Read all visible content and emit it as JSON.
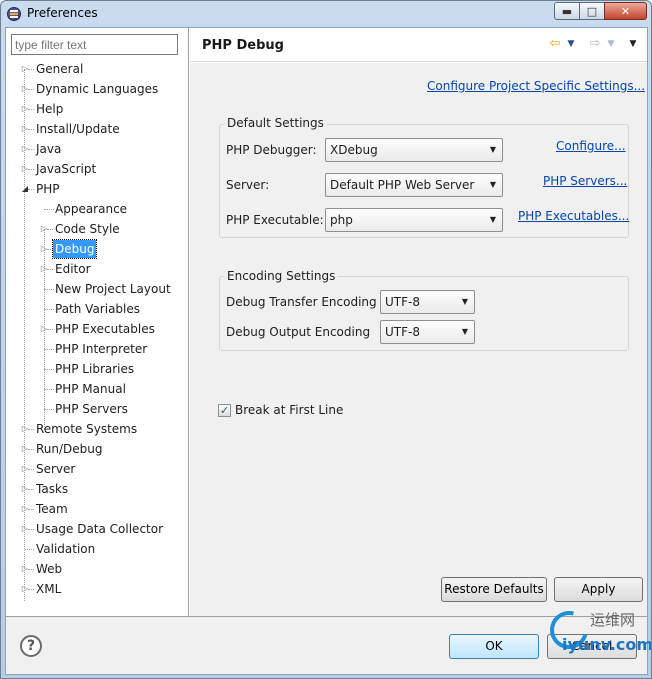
{
  "window": {
    "title": "Preferences"
  },
  "filter": {
    "placeholder": "type filter text"
  },
  "tree": {
    "general": "General",
    "dynamic_languages": "Dynamic Languages",
    "help": "Help",
    "install_update": "Install/Update",
    "java": "Java",
    "javascript": "JavaScript",
    "php": "PHP",
    "appearance": "Appearance",
    "code_style": "Code Style",
    "debug": "Debug",
    "editor": "Editor",
    "new_project_layout": "New Project Layout",
    "path_variables": "Path Variables",
    "php_executables": "PHP Executables",
    "php_interpreter": "PHP Interpreter",
    "php_libraries": "PHP Libraries",
    "php_manual": "PHP Manual",
    "php_servers": "PHP Servers",
    "remote_systems": "Remote Systems",
    "run_debug": "Run/Debug",
    "server": "Server",
    "tasks": "Tasks",
    "team": "Team",
    "usage_data_collector": "Usage Data Collector",
    "validation": "Validation",
    "web": "Web",
    "xml": "XML"
  },
  "page": {
    "title": "PHP Debug",
    "configure_project_link": "Configure Project Specific Settings...",
    "default_settings": {
      "title": "Default Settings",
      "debugger_label": "PHP Debugger:",
      "debugger_value": "XDebug",
      "configure_link": "Configure...",
      "server_label": "Server:",
      "server_value": "Default PHP Web Server",
      "servers_link": "PHP Servers...",
      "executable_label": "PHP Executable:",
      "executable_value": "php",
      "executables_link": "PHP Executables..."
    },
    "encoding_settings": {
      "title": "Encoding Settings",
      "transfer_label": "Debug Transfer Encoding",
      "transfer_value": "UTF-8",
      "output_label": "Debug Output Encoding",
      "output_value": "UTF-8"
    },
    "break_first_line": {
      "label": "Break at First Line",
      "checked": true
    },
    "restore_defaults": "Restore Defaults",
    "apply": "Apply"
  },
  "footer": {
    "ok": "OK",
    "cancel": "Cancel"
  },
  "watermark": {
    "top": "运维网",
    "bottom": "iyunv.com"
  },
  "colors": {
    "selection": "#3399ff",
    "link": "#0645ad",
    "panel": "#f0f0f0"
  }
}
